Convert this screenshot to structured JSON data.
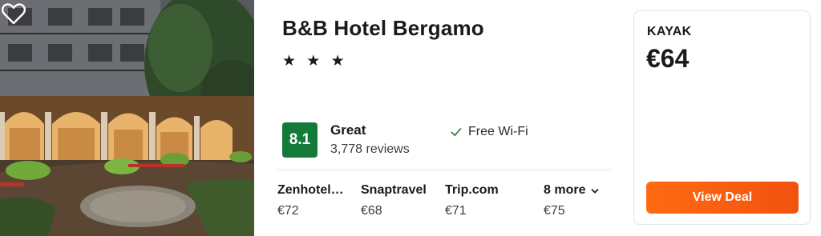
{
  "hotel": {
    "name": "B&B Hotel Bergamo",
    "stars": "★ ★ ★",
    "star_count": 3
  },
  "rating": {
    "score": "8.1",
    "label": "Great",
    "reviews": "3,778 reviews",
    "color": "#147a3a"
  },
  "amenities": [
    {
      "label": "Free Wi-Fi",
      "icon": "check-icon"
    }
  ],
  "providers": [
    {
      "name": "Zenhotel…",
      "price": "€72"
    },
    {
      "name": "Snaptravel",
      "price": "€68"
    },
    {
      "name": "Trip.com",
      "price": "€71"
    },
    {
      "name": "8 more",
      "price": "€75",
      "icon": "chevron-down-icon"
    }
  ],
  "deal": {
    "source": "KAYAK",
    "price": "€64",
    "button_label": "View Deal",
    "accent": "#ff6a13"
  },
  "photo": {
    "icon": "heart-icon"
  }
}
